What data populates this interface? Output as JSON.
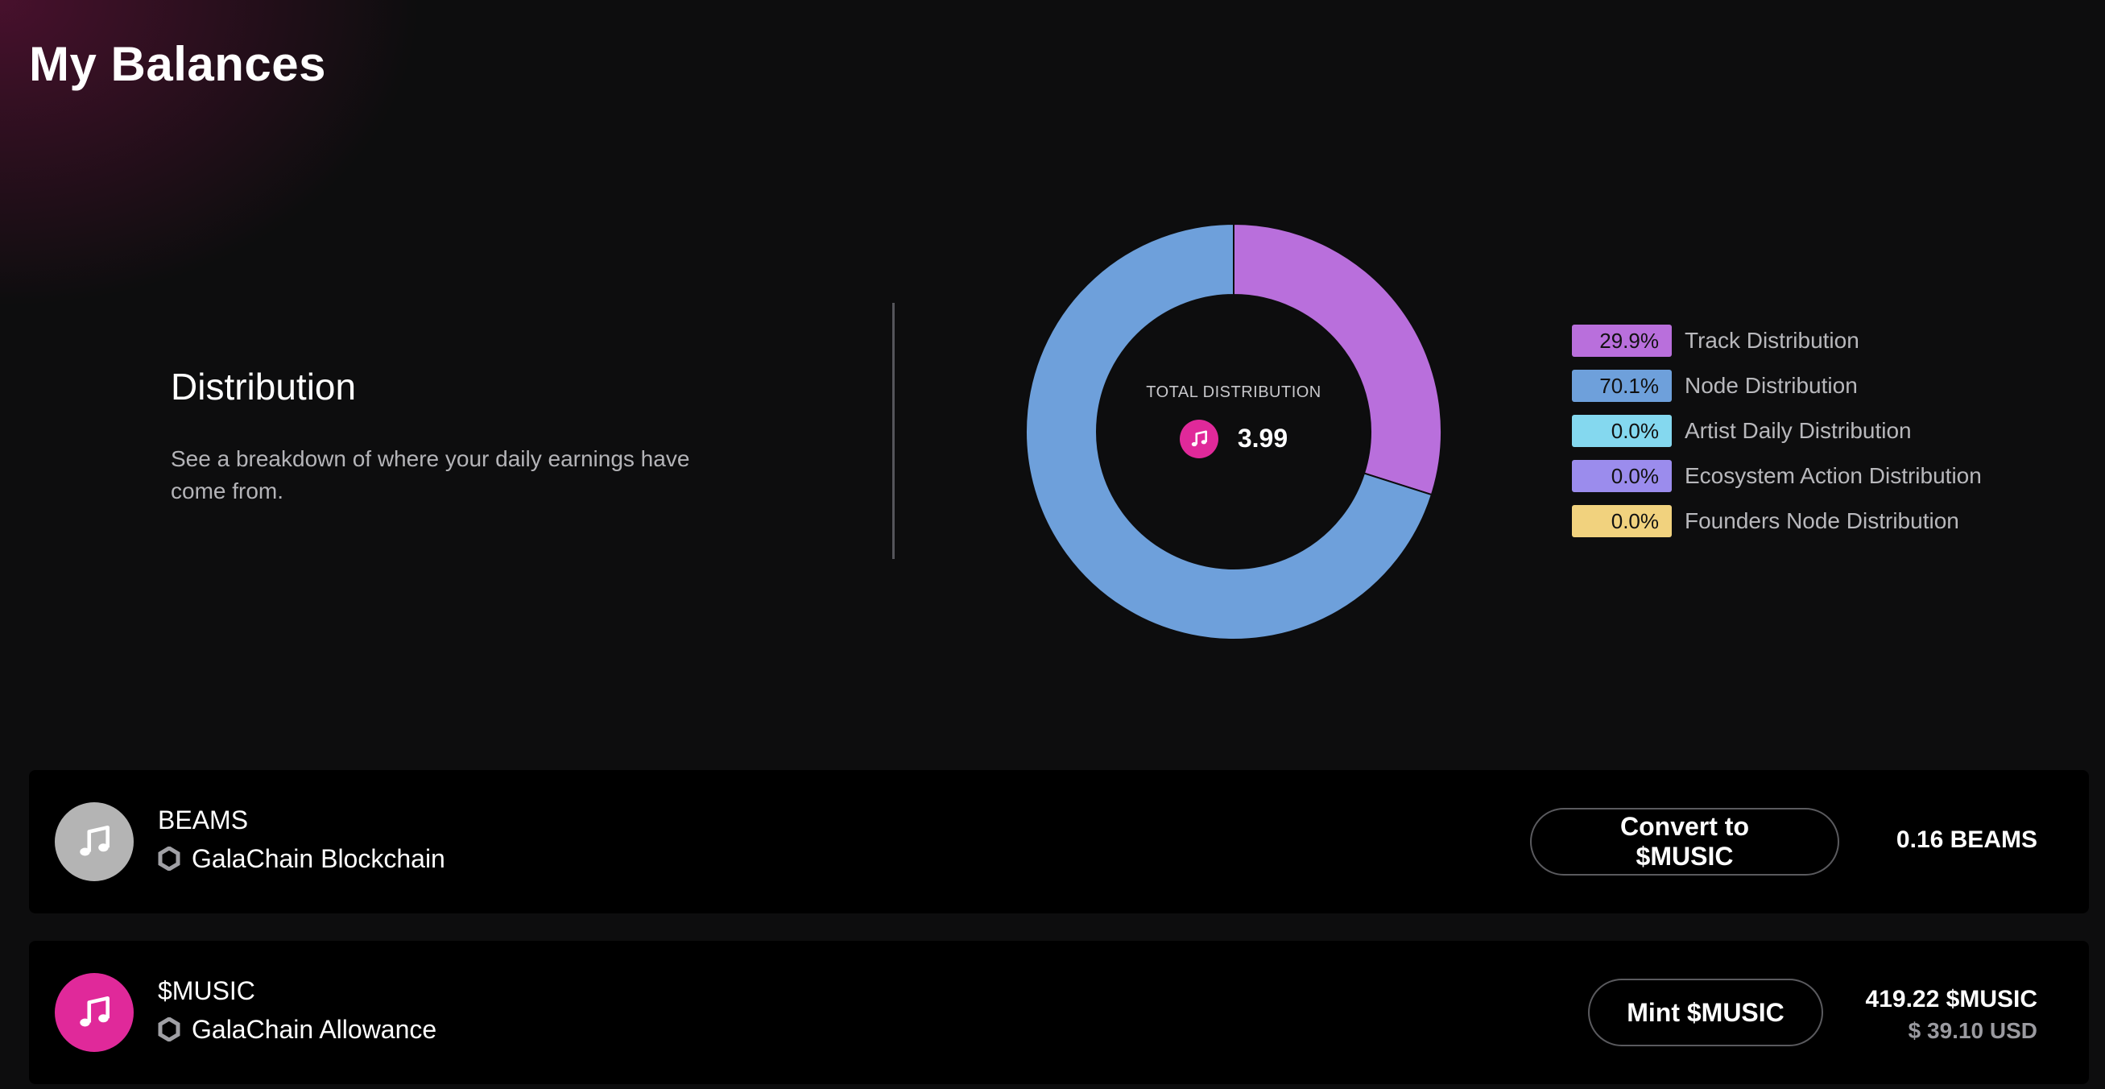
{
  "page": {
    "title": "My Balances"
  },
  "distribution": {
    "heading": "Distribution",
    "description": "See a breakdown of where your daily earnings have come from.",
    "total_label": "TOTAL DISTRIBUTION",
    "total_value": "3.99",
    "coin_icon": "music-note-icon",
    "legend": [
      {
        "percent_label": "29.9%",
        "label": "Track Distribution",
        "value": 29.9,
        "color": "#b96fdc"
      },
      {
        "percent_label": "70.1%",
        "label": "Node Distribution",
        "value": 70.1,
        "color": "#6ea0db"
      },
      {
        "percent_label": "0.0%",
        "label": "Artist Daily Distribution",
        "value": 0.0,
        "color": "#84d8ef"
      },
      {
        "percent_label": "0.0%",
        "label": "Ecosystem Action Distribution",
        "value": 0.0,
        "color": "#9b8ced"
      },
      {
        "percent_label": "0.0%",
        "label": "Founders Node Distribution",
        "value": 0.0,
        "color": "#f1d27e"
      }
    ]
  },
  "chart_data": {
    "type": "pie",
    "categories": [
      "Track Distribution",
      "Node Distribution",
      "Artist Daily Distribution",
      "Ecosystem Action Distribution",
      "Founders Node Distribution"
    ],
    "values": [
      29.9,
      70.1,
      0.0,
      0.0,
      0.0
    ],
    "colors": [
      "#b96fdc",
      "#6ea0db",
      "#84d8ef",
      "#9b8ced",
      "#f1d27e"
    ],
    "title": "",
    "center_label": "TOTAL DISTRIBUTION",
    "center_value": "3.99",
    "legend_position": "right"
  },
  "balances": [
    {
      "token": "BEAMS",
      "chain": "GalaChain Blockchain",
      "action_label": "Convert to $MUSIC",
      "amount": "0.16 BEAMS",
      "usd": "",
      "avatar_color": "#b4b4b4",
      "icon": "music-note-icon",
      "chain_icon": "hexagon-icon"
    },
    {
      "token": "$MUSIC",
      "chain": "GalaChain Allowance",
      "action_label": "Mint $MUSIC",
      "amount": "419.22 $MUSIC",
      "usd": "$ 39.10 USD",
      "avatar_color": "#e0299a",
      "icon": "music-note-icon",
      "chain_icon": "hexagon-icon"
    }
  ]
}
